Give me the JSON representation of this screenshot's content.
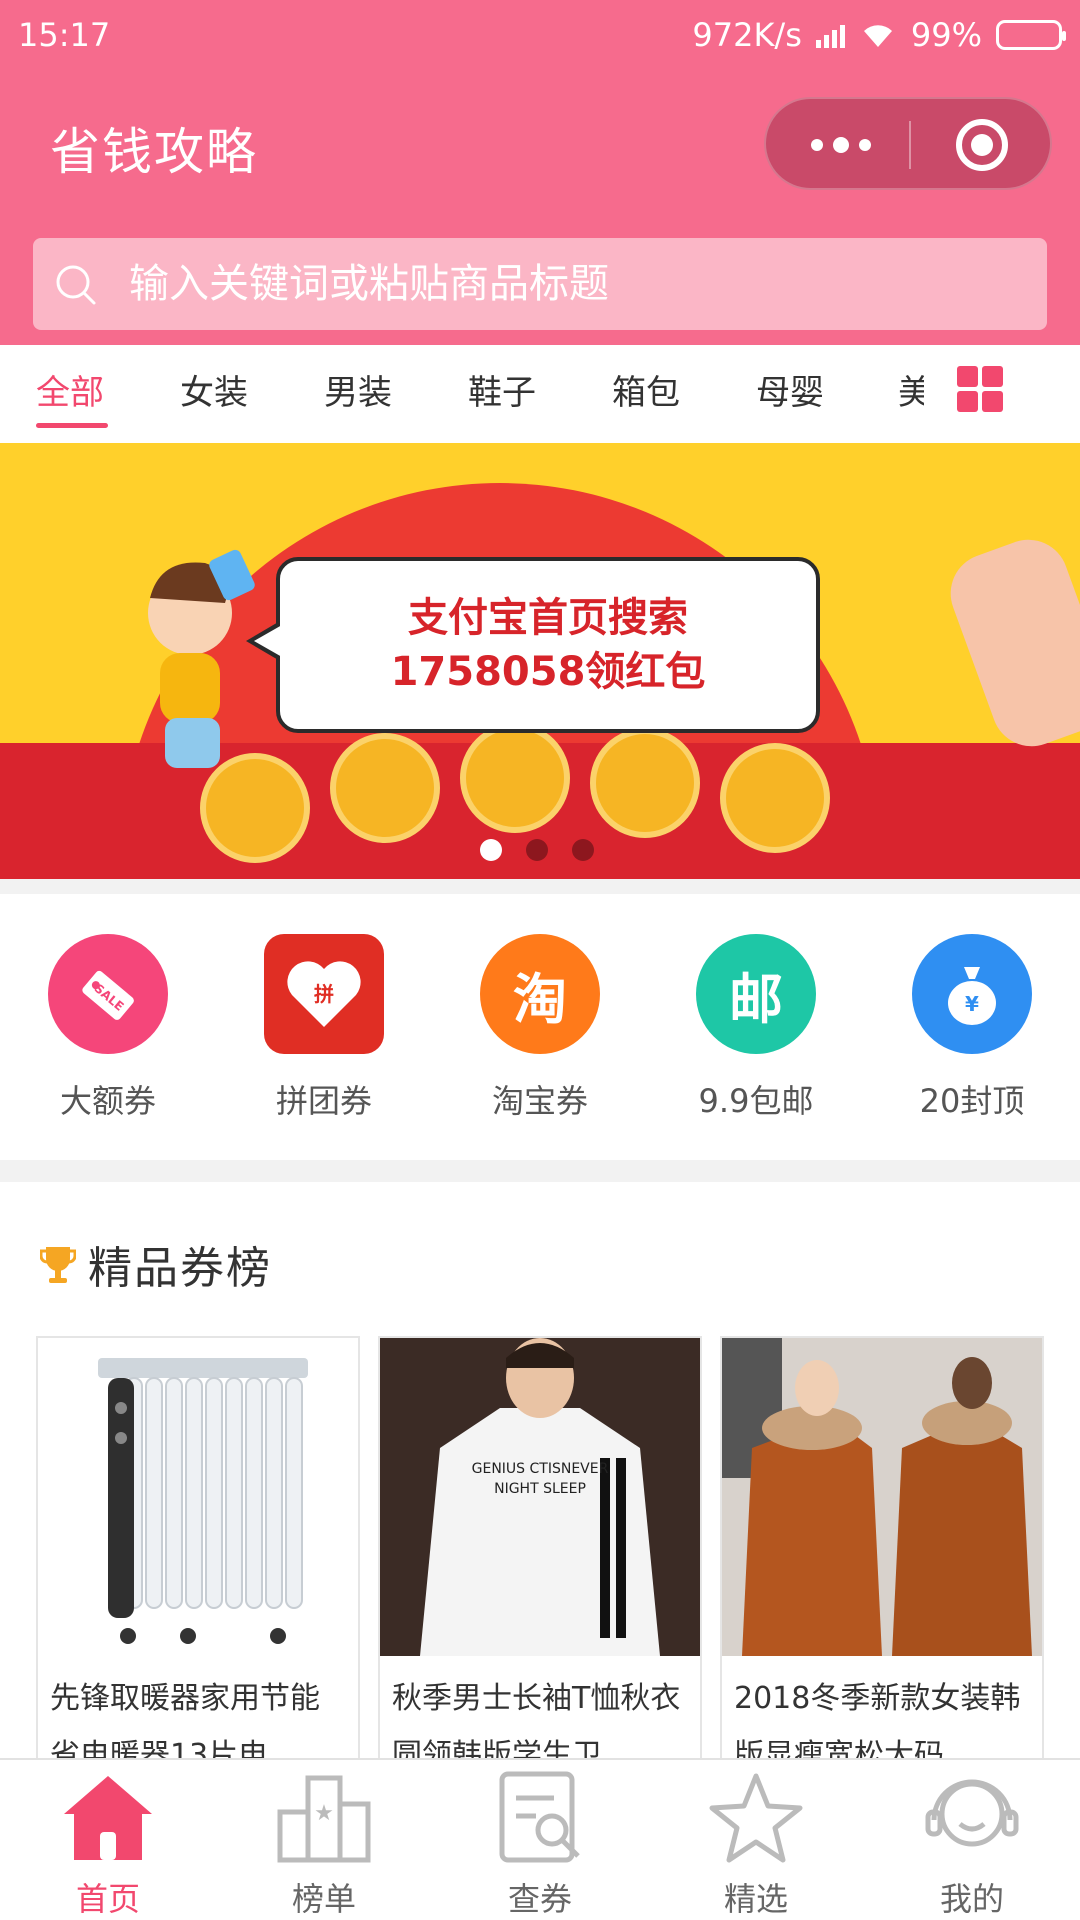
{
  "status_bar": {
    "time": "15:17",
    "net_speed": "972K/s",
    "battery": "99%"
  },
  "header": {
    "title": "省钱攻略",
    "more_button_icon": "more-dots-icon",
    "close_button_icon": "target-close-icon"
  },
  "search": {
    "placeholder": "输入关键词或粘贴商品标题"
  },
  "tabs": {
    "items": [
      "全部",
      "女装",
      "男装",
      "鞋子",
      "箱包",
      "母婴"
    ],
    "clipped": "美",
    "active": "全部"
  },
  "banner": {
    "line1": "支付宝首页搜索",
    "line2": "1758058领红包",
    "active_slide_index": 0
  },
  "quick_entries": [
    {
      "label": "大额券",
      "icon": "sale-tag-icon",
      "color": "#f5467a"
    },
    {
      "label": "拼团券",
      "icon": "pinduoduo-heart-icon",
      "color": "#e02e24"
    },
    {
      "label": "淘宝券",
      "icon": "taobao-icon",
      "glyph": "淘",
      "color": "#ff7a1a"
    },
    {
      "label": "9.9包邮",
      "icon": "mail-icon",
      "glyph": "邮",
      "color": "#1ec7a6"
    },
    {
      "label": "20封顶",
      "icon": "money-bag-icon",
      "color": "#2f8ff2"
    }
  ],
  "section": {
    "title": "精品券榜",
    "cards": [
      {
        "title": "先锋取暖器家用节能省电暖器13片电",
        "image": "oil-heater-photo"
      },
      {
        "title": "秋季男士长袖T恤秋衣圆领韩版学生卫",
        "image": "mens-tshirt-photo"
      },
      {
        "title": "2018冬季新款女装韩版显瘦宽松大码",
        "image": "womens-coat-photo"
      }
    ]
  },
  "bottom_nav": {
    "items": [
      {
        "label": "首页",
        "icon": "home-icon"
      },
      {
        "label": "榜单",
        "icon": "ranking-icon"
      },
      {
        "label": "查券",
        "icon": "search-coupon-icon"
      },
      {
        "label": "精选",
        "icon": "star-icon"
      },
      {
        "label": "我的",
        "icon": "user-icon"
      }
    ],
    "active": "首页"
  },
  "colors": {
    "brand": "#f66b8d",
    "accent": "#f2486e"
  }
}
